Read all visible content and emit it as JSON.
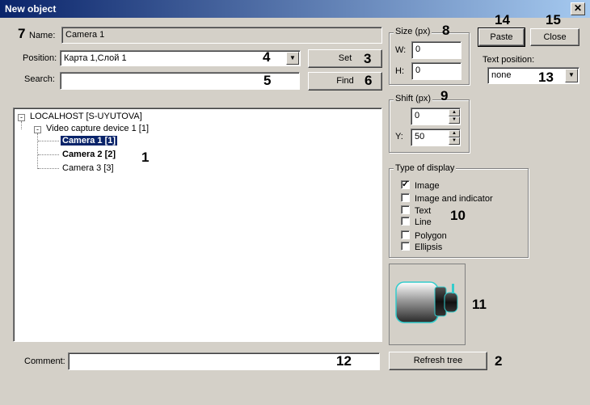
{
  "window": {
    "title": "New object",
    "close_glyph": "✕"
  },
  "form": {
    "name_label": "Name:",
    "name_value": "Camera 1",
    "position_label": "Position:",
    "position_value": "Карта 1,Слой 1",
    "search_label": "Search:",
    "search_value": "",
    "set_label": "Set",
    "find_label": "Find",
    "comment_label": "Comment:",
    "comment_value": "",
    "refresh_label": "Refresh tree"
  },
  "size": {
    "title": "Size (px)",
    "w_label": "W:",
    "w_value": "0",
    "h_label": "H:",
    "h_value": "0"
  },
  "shift": {
    "title": "Shift (px)",
    "x_value": "0",
    "y_label": "Y:",
    "y_value": "50"
  },
  "buttons": {
    "paste": "Paste",
    "close": "Close"
  },
  "text_position": {
    "label": "Text position:",
    "value": "none"
  },
  "display": {
    "title": "Type of display",
    "options": [
      {
        "label": "Image",
        "checked": true
      },
      {
        "label": "Image and indicator",
        "checked": false
      },
      {
        "label": "Text",
        "checked": false
      },
      {
        "label": "Line",
        "checked": false
      },
      {
        "label": "Polygon",
        "checked": false
      },
      {
        "label": "Ellipsis",
        "checked": false
      }
    ]
  },
  "tree": {
    "root": "LOCALHOST [S-UYUTOVA]",
    "device": "Video capture device 1 [1]",
    "cameras": [
      "Camera 1 [1]",
      "Camera 2 [2]",
      "Camera 3 [3]"
    ]
  },
  "callouts": [
    "1",
    "2",
    "3",
    "4",
    "5",
    "6",
    "7",
    "8",
    "9",
    "10",
    "11",
    "12",
    "13",
    "14",
    "15"
  ],
  "preview": {
    "icon": "camera-icon"
  }
}
